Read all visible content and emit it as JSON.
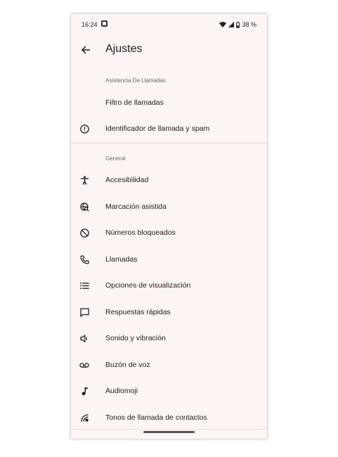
{
  "status_bar": {
    "time": "16:24",
    "battery": "38 %"
  },
  "app_bar": {
    "title": "Ajustes"
  },
  "sections": [
    {
      "header": "Asistencia De Llamadas",
      "items": [
        {
          "label": "Filtro de llamadas",
          "icon": "none"
        },
        {
          "label": "Identificador de llamada y spam",
          "icon": "alert-circle-icon"
        }
      ]
    },
    {
      "header": "General",
      "items": [
        {
          "label": "Accesibilidad",
          "icon": "accessibility-icon"
        },
        {
          "label": "Marcación asistida",
          "icon": "assisted-dialing-icon"
        },
        {
          "label": "Números bloqueados",
          "icon": "block-icon"
        },
        {
          "label": "Llamadas",
          "icon": "phone-icon"
        },
        {
          "label": "Opciones de visualización",
          "icon": "list-icon"
        },
        {
          "label": "Respuestas rápidas",
          "icon": "chat-bubble-icon"
        },
        {
          "label": "Sonido y vibración",
          "icon": "volume-icon"
        },
        {
          "label": "Buzón de voz",
          "icon": "voicemail-icon"
        },
        {
          "label": "Audiomoji",
          "icon": "music-note-icon"
        },
        {
          "label": "Tonos de llamada de contactos",
          "icon": "contact-ringtone-icon"
        }
      ]
    }
  ]
}
